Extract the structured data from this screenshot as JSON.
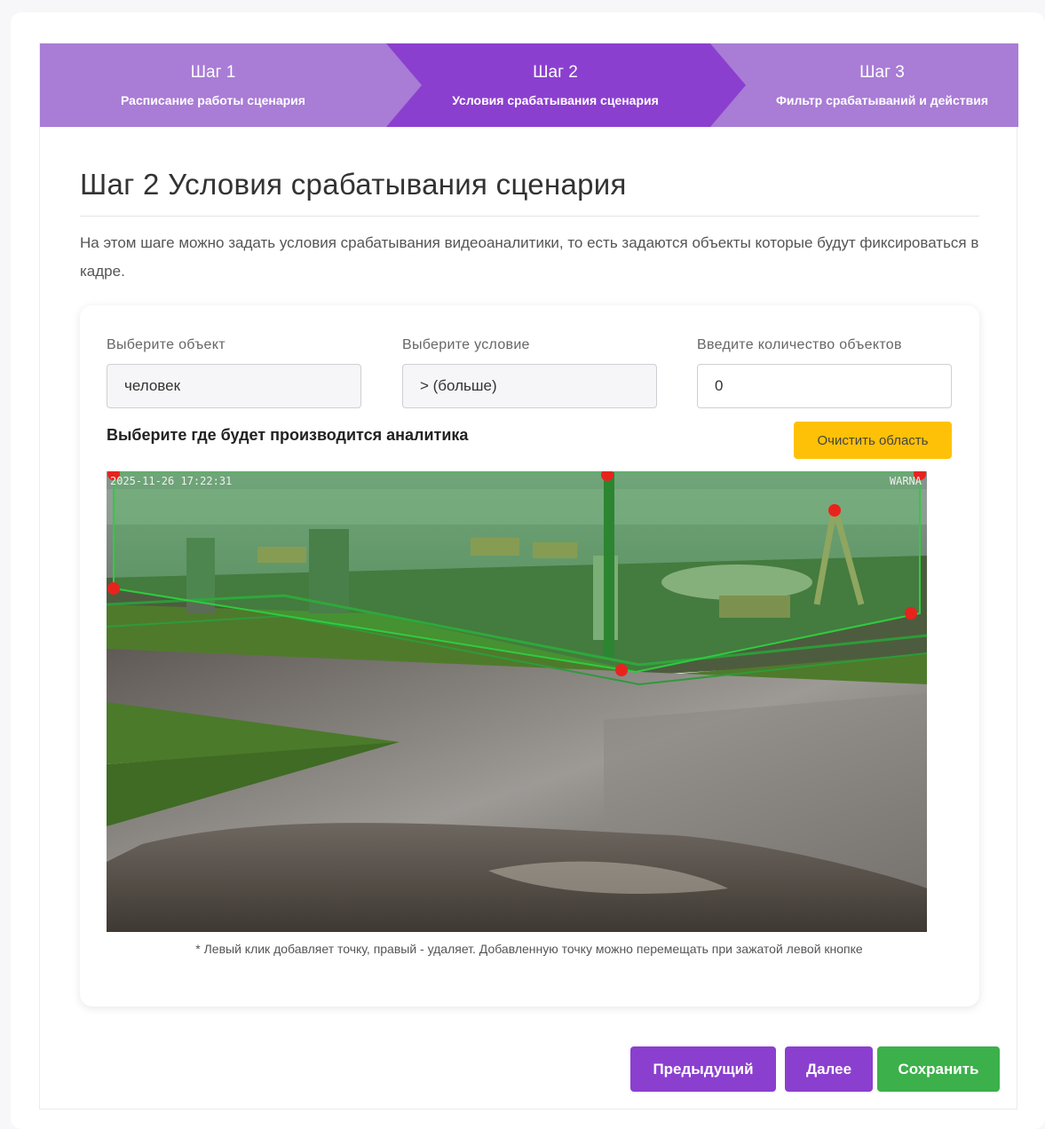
{
  "stepper": {
    "steps": [
      {
        "num": "Шаг 1",
        "desc": "Расписание работы сценария"
      },
      {
        "num": "Шаг 2",
        "desc": "Условия срабатывания сценария"
      },
      {
        "num": "Шаг 3",
        "desc": "Фильтр срабатываний и действия"
      }
    ]
  },
  "main": {
    "title": "Шаг 2 Условия срабатывания сценария",
    "intro": "На этом шаге можно задать условия срабатывания видеоаналитики, то есть задаются объекты которые будут фиксироваться в кадре."
  },
  "form": {
    "object": {
      "label": "Выберите объект",
      "value": "человек"
    },
    "condition": {
      "label": "Выберите условие",
      "value": "> (больше)"
    },
    "count": {
      "label": "Введите количество объектов",
      "value": "0"
    }
  },
  "area": {
    "label": "Выберите где будет производится аналитика",
    "clear_label": "Очистить область",
    "hint": "* Левый клик добавляет точку, правый - удаляет. Добавленную точку можно перемещать при зажатой левой кнопке"
  },
  "camera": {
    "timestamp": "2025-11-26 17:22:31",
    "brand": "WARNA",
    "zone_color": "#2ecc40",
    "point_color": "#e8231e"
  },
  "footer": {
    "prev_label": "Предыдущий",
    "next_label": "Далее",
    "save_label": "Сохранить"
  }
}
